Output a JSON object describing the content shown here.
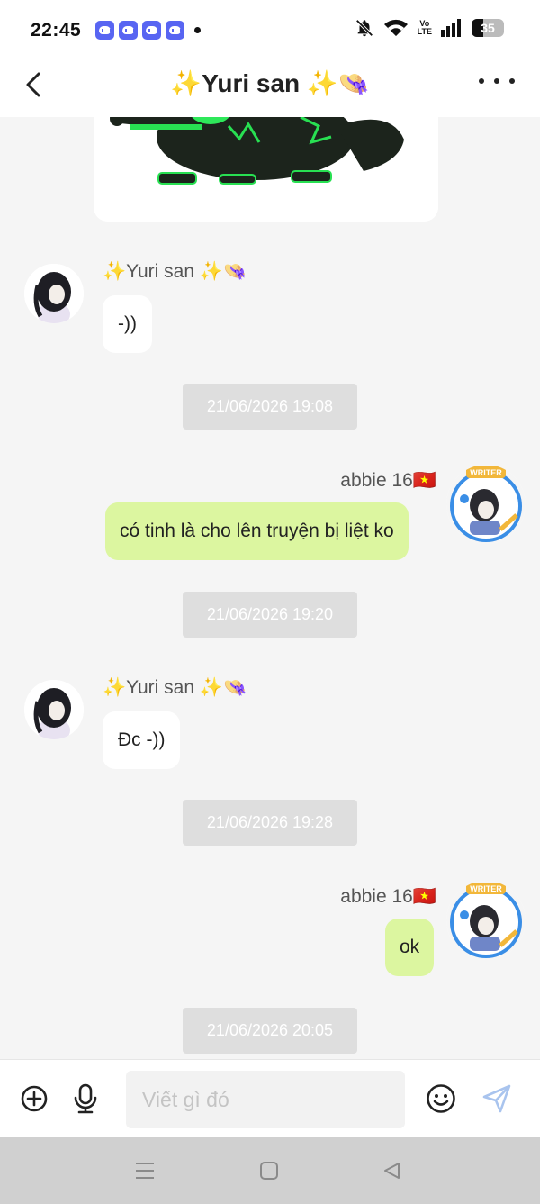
{
  "status_bar": {
    "time": "22:45",
    "notification_icons": [
      "discord-icon",
      "discord-icon",
      "discord-icon",
      "discord-icon"
    ],
    "system_icons": [
      "mute-bell-icon",
      "wifi-icon",
      "volte-icon",
      "signal-icon",
      "battery-icon"
    ],
    "volte_top": "Vo",
    "volte_bottom": "LTE",
    "battery_level": "35"
  },
  "header": {
    "title": "✨Yuri san ✨👒",
    "back_icon": "chevron-left-icon",
    "more_icon": "more-dots-icon"
  },
  "messages": [
    {
      "type": "incoming",
      "sender": "✨Yuri san ✨👒",
      "text": "-))"
    },
    {
      "type": "timestamp",
      "text": "21/06/2026 19:08"
    },
    {
      "type": "outgoing",
      "sender": "abbie 16🇻🇳",
      "text": "có tinh là cho lên truyện bị liệt ko"
    },
    {
      "type": "timestamp",
      "text": "21/06/2026 19:20"
    },
    {
      "type": "incoming",
      "sender": "✨Yuri san ✨👒",
      "text": "Đc -))"
    },
    {
      "type": "timestamp",
      "text": "21/06/2026 19:28"
    },
    {
      "type": "outgoing",
      "sender": "abbie 16🇻🇳",
      "text": "ok"
    },
    {
      "type": "timestamp",
      "text": "21/06/2026 20:05"
    }
  ],
  "input_bar": {
    "placeholder": "Viết gì đó",
    "value": "",
    "icons": [
      "add-circle-icon",
      "microphone-icon",
      "emoji-icon",
      "send-icon"
    ]
  },
  "colors": {
    "outgoing_bubble": "#dcf6a0",
    "incoming_bubble": "#ffffff",
    "chat_background": "#f5f5f5",
    "timestamp_pill": "#dedede",
    "discord_brand": "#5865f2",
    "send_icon": "#a9c4ee"
  }
}
